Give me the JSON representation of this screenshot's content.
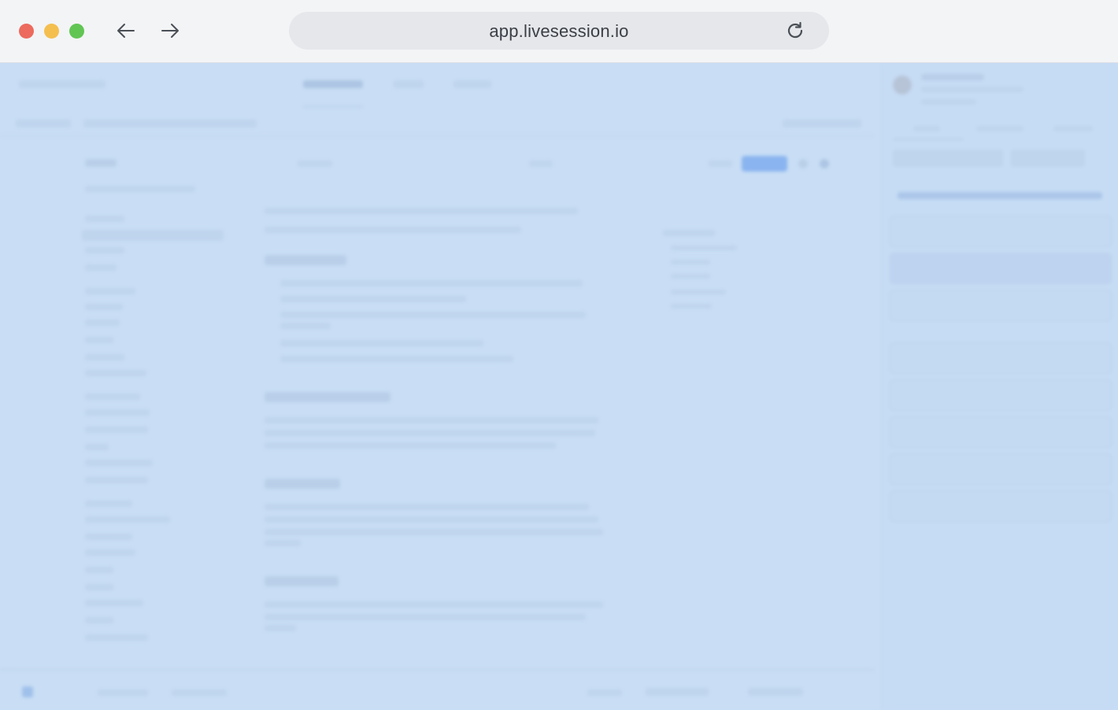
{
  "browser": {
    "url": "app.livesession.io",
    "back_icon": "arrow-left-icon",
    "forward_icon": "arrow-right-icon",
    "reload_icon": "reload-icon"
  },
  "colors": {
    "traffic_red": "#ec6a5e",
    "traffic_yellow": "#f4bf4f",
    "traffic_green": "#61c554",
    "overlay": "#c9def5"
  }
}
